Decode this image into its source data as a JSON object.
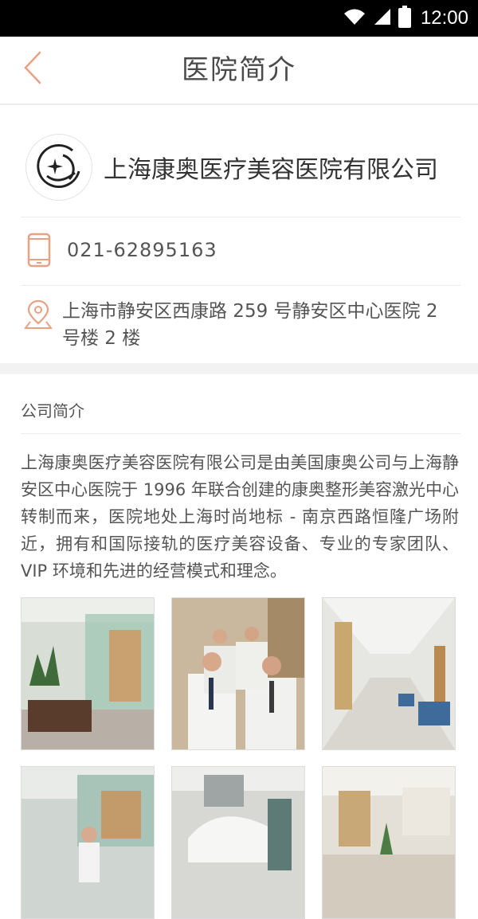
{
  "status_bar": {
    "time": "12:00"
  },
  "header": {
    "title": "医院简介",
    "back_icon": "chevron-left-icon"
  },
  "company": {
    "name": "上海康奥医疗美容医院有限公司",
    "logo_icon": "sparkle-circle-logo"
  },
  "contact": {
    "phone": "021-62895163",
    "phone_icon": "mobile-phone-icon",
    "address": "上海市静安区西康路 259 号静安区中心医院 2 号楼 2 楼",
    "address_icon": "location-pin-icon"
  },
  "section": {
    "title": "公司简介",
    "body": "上海康奥医疗美容医院有限公司是由美国康奥公司与上海静安区中心医院于 1996 年联合创建的康奥整形美容激光中心转制而来，医院地处上海时尚地标 - 南京西路恒隆广场附近，拥有和国际接轨的医疗美容设备、专业的专家团队、VIP 环境和先进的经营模式和理念。"
  },
  "colors": {
    "accent": "#e8a183",
    "text": "#4a4a4a",
    "divider": "#ececec"
  },
  "gallery": [
    "lobby-photo",
    "doctors-team-photo",
    "corridor-photo",
    "nurse-room-photo",
    "treatment-room-photo",
    "reception-hall-photo"
  ]
}
